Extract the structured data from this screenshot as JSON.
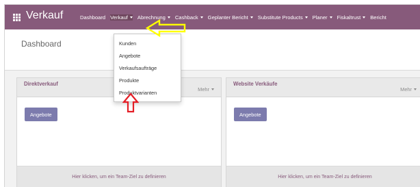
{
  "app": {
    "name": "Verkauf"
  },
  "navbar": {
    "items": [
      {
        "label": "Dashboard"
      },
      {
        "label": "Verkauf"
      },
      {
        "label": "Abrechnung"
      },
      {
        "label": "Cashback"
      },
      {
        "label": "Geplanter Bericht"
      },
      {
        "label": "Substitute Products"
      },
      {
        "label": "Planer"
      },
      {
        "label": "Fiskaltrust"
      },
      {
        "label": "Bericht"
      }
    ]
  },
  "page": {
    "title": "Dashboard"
  },
  "dropdown": {
    "items": [
      {
        "label": "Kunden"
      },
      {
        "label": "Angebote"
      },
      {
        "label": "Verkaufsaufträge"
      },
      {
        "label": "Produkte"
      },
      {
        "label": "Produktvarianten"
      }
    ]
  },
  "cards": [
    {
      "title": "Direktverkauf",
      "more": "Mehr",
      "button": "Angebote",
      "footer": "Hier klicken, um ein Team-Ziel zu definieren"
    },
    {
      "title": "Website Verkäufe",
      "more": "Mehr",
      "button": "Angebote",
      "footer": "Hier klicken, um ein Team-Ziel zu definieren"
    }
  ],
  "colors": {
    "brand": "#875a7b",
    "button": "#7c7bad",
    "highlight_arrow": "#ffff00",
    "pointer_arrow": "#e41e26"
  }
}
